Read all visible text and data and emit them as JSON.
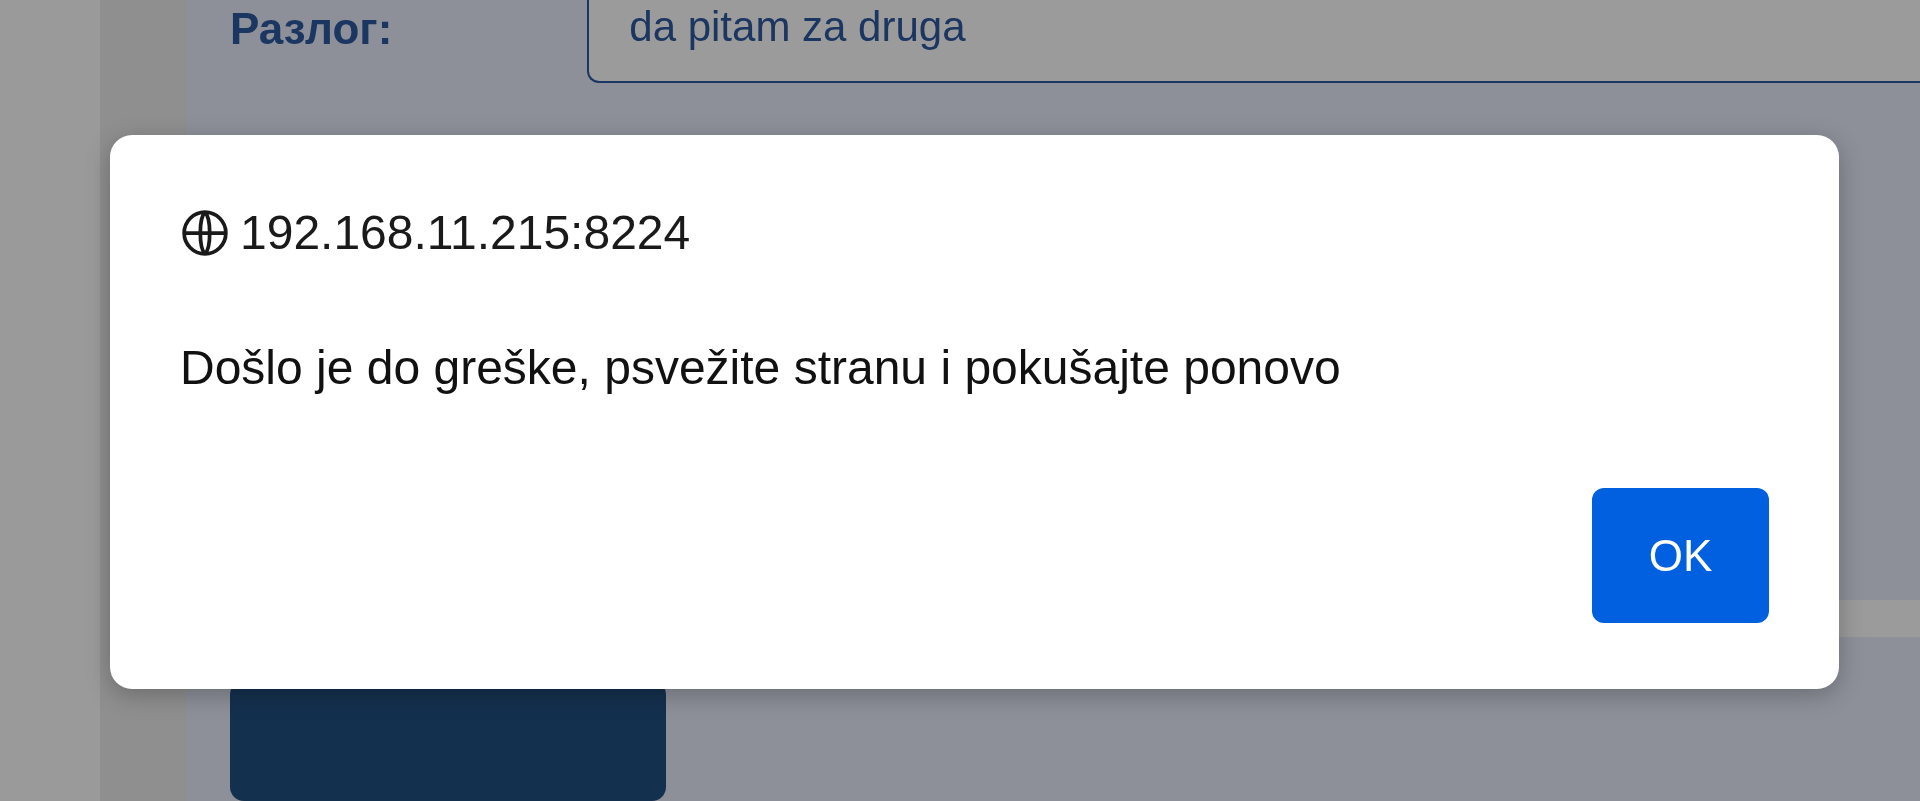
{
  "form": {
    "reason_label": "Разлог:",
    "reason_value": "da pitam za druga"
  },
  "dialog": {
    "origin": "192.168.11.215:8224",
    "message": "Došlo je do greške, psvežite stranu i pokušajte ponovo",
    "button": "OK"
  }
}
